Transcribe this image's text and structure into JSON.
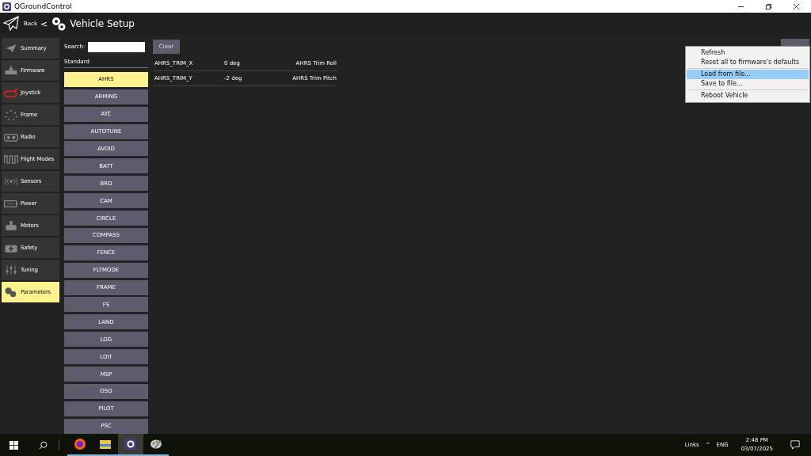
{
  "window": {
    "title": "QGroundControl"
  },
  "header": {
    "back": "Back",
    "separator": "<",
    "title": "Vehicle Setup"
  },
  "sidebar": {
    "items": [
      {
        "label": "Summary",
        "selected": false
      },
      {
        "label": "Firmware",
        "selected": false
      },
      {
        "label": "Joystick",
        "selected": false
      },
      {
        "label": "Frame",
        "selected": false
      },
      {
        "label": "Radio",
        "selected": false
      },
      {
        "label": "Flight Modes",
        "selected": false
      },
      {
        "label": "Sensors",
        "selected": false
      },
      {
        "label": "Power",
        "selected": false
      },
      {
        "label": "Motors",
        "selected": false
      },
      {
        "label": "Safety",
        "selected": false
      },
      {
        "label": "Tuning",
        "selected": false
      },
      {
        "label": "Parameters",
        "selected": true
      }
    ]
  },
  "search": {
    "label": "Search:",
    "clear": "Clear"
  },
  "groups": {
    "heading": "Standard",
    "items": [
      {
        "label": "AHRS",
        "selected": true
      },
      {
        "label": "ARMING",
        "selected": false
      },
      {
        "label": "ATC",
        "selected": false
      },
      {
        "label": "AUTOTUNE",
        "selected": false
      },
      {
        "label": "AVOID",
        "selected": false
      },
      {
        "label": "BATT",
        "selected": false
      },
      {
        "label": "BRD",
        "selected": false
      },
      {
        "label": "CAM",
        "selected": false
      },
      {
        "label": "CIRCLE",
        "selected": false
      },
      {
        "label": "COMPASS",
        "selected": false
      },
      {
        "label": "FENCE",
        "selected": false
      },
      {
        "label": "FLTMODE",
        "selected": false
      },
      {
        "label": "FRAME",
        "selected": false
      },
      {
        "label": "FS",
        "selected": false
      },
      {
        "label": "LAND",
        "selected": false
      },
      {
        "label": "LOG",
        "selected": false
      },
      {
        "label": "LOIT",
        "selected": false
      },
      {
        "label": "MSP",
        "selected": false
      },
      {
        "label": "OSD",
        "selected": false
      },
      {
        "label": "PILOT",
        "selected": false
      },
      {
        "label": "PSC",
        "selected": false
      }
    ]
  },
  "parameters": [
    {
      "name": "AHRS_TRIM_X",
      "value": "0 deg",
      "description": "AHRS Trim Roll"
    },
    {
      "name": "AHRS_TRIM_Y",
      "value": "-2 deg",
      "description": "AHRS Trim Pitch"
    }
  ],
  "menu": [
    {
      "kind": "item",
      "label": "Refresh",
      "selected": false
    },
    {
      "kind": "item",
      "label": "Reset all to firmware's defaults",
      "selected": false
    },
    {
      "kind": "separator"
    },
    {
      "kind": "item",
      "label": "Load from file...",
      "selected": true
    },
    {
      "kind": "item",
      "label": "Save to file...",
      "selected": false
    },
    {
      "kind": "separator"
    },
    {
      "kind": "item",
      "label": "Reboot Vehicle",
      "selected": false
    }
  ],
  "taskbar": {
    "apps": [
      {
        "active": false
      },
      {
        "active": false
      },
      {
        "active": true
      },
      {
        "active": false
      }
    ],
    "tray": {
      "links": "Links",
      "caret": "^",
      "language": "ENG",
      "time": "2:48 PM",
      "date": "03/07/2025"
    }
  }
}
